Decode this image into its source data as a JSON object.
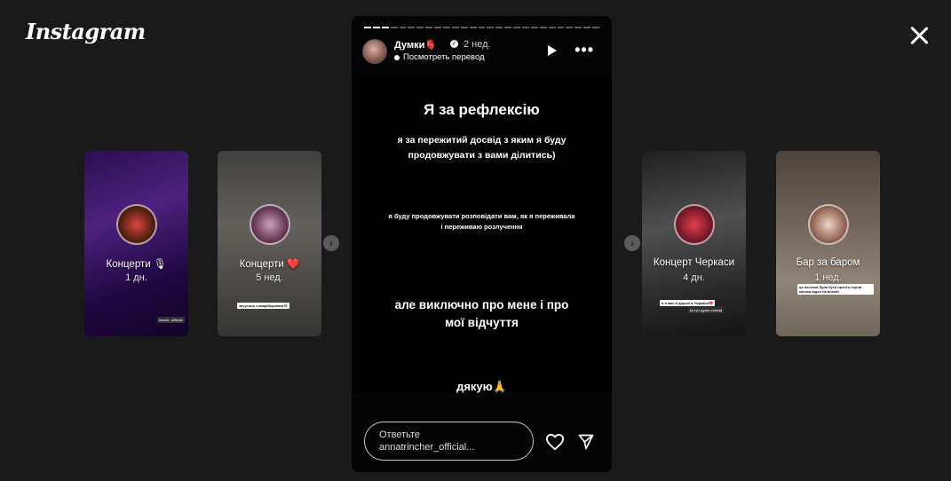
{
  "app": {
    "logo_text": "Instagram"
  },
  "story": {
    "username": "Думки",
    "username_emoji": "🫀",
    "time_ago": "2 нед.",
    "translate_label": "Посмотреть перевод",
    "progress": {
      "segments_total": 27,
      "segments_done": 3
    },
    "lines": {
      "heading": "Я за рефлексію",
      "line2": "я за пережитий досвід з яким я буду продовжувати з вами ділитись)",
      "line3": "я буду продовжувати розповідати вам, як я переживала і переживаю розлучення",
      "line4": "але виключно про мене і про мої відчуття",
      "line5": "дякую🙏"
    },
    "reply_placeholder_line1": "Ответьте",
    "reply_placeholder_line2": "annatrincher_official..."
  },
  "side_stories": [
    {
      "title": "Концерти 🎙",
      "age": "1 дн.",
      "sticker": "trnchr_official"
    },
    {
      "title": "Концерти ❤️",
      "age": "5 нед.",
      "sticker": "затусила з аварійщиками😂"
    },
    {
      "title": "Концерт Черкаси",
      "age": "4 дн.",
      "sticker": "я в вже в дорозі в Черкаси❤️",
      "sticker2": "(я тут дуже сонна)"
    },
    {
      "title": "Бар за баром",
      "age": "1 нед.",
      "sticker": "це песочка була бути просто чорна міннка відео на вінчан"
    }
  ],
  "icons": {
    "close": "close-icon",
    "play": "play-icon",
    "more": "more-icon",
    "heart": "heart-icon",
    "send": "send-icon",
    "prev": "chevron-left-icon",
    "next": "chevron-right-icon",
    "verified": "verified-icon"
  },
  "colors": {
    "background": "#1a1a1a",
    "story_bg": "#000000",
    "text": "#ffffff"
  }
}
